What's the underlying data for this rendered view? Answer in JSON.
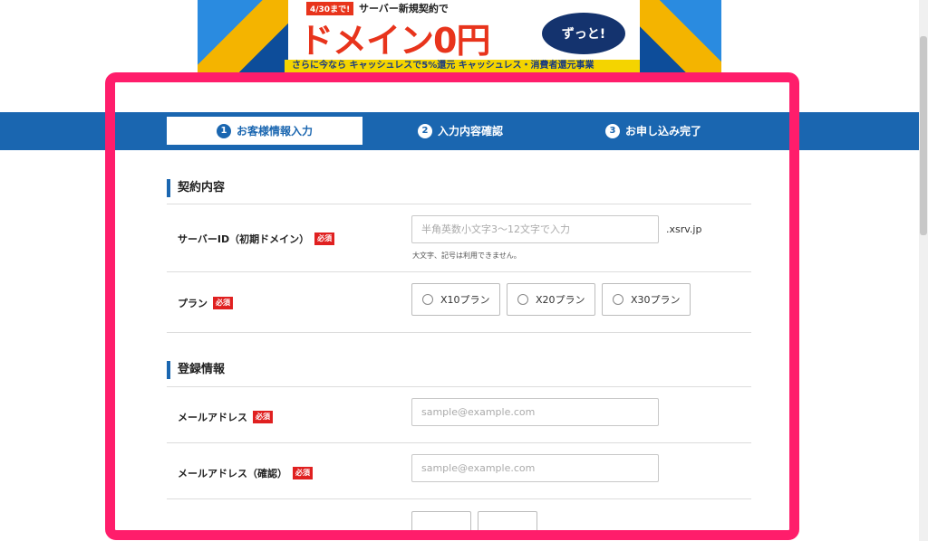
{
  "banner": {
    "date_tag": "4/30まで!",
    "lead": "サーバー新規契約で",
    "headline": "ドメイン0円",
    "bubble": "ずっと!",
    "bottom_strip": "さらに今なら キャッシュレスで5%還元 キャッシュレス・消費者還元事業"
  },
  "steps": [
    {
      "num": "1",
      "label": "お客様情報入力",
      "active": true
    },
    {
      "num": "2",
      "label": "入力内容確認",
      "active": false
    },
    {
      "num": "3",
      "label": "お申し込み完了",
      "active": false
    }
  ],
  "sections": {
    "contract": {
      "title": "契約内容"
    },
    "registration": {
      "title": "登録情報"
    }
  },
  "required_badge": "必須",
  "fields": {
    "server_id": {
      "label": "サーバーID（初期ドメイン）",
      "placeholder": "半角英数小文字3〜12文字で入力",
      "value": "",
      "suffix": ".xsrv.jp",
      "note": "大文字、記号は利用できません。"
    },
    "plan": {
      "label": "プラン",
      "options": [
        "X10プラン",
        "X20プラン",
        "X30プラン"
      ]
    },
    "email": {
      "label": "メールアドレス",
      "placeholder": "sample@example.com",
      "value": ""
    },
    "email_confirm": {
      "label": "メールアドレス（確認）",
      "placeholder": "sample@example.com",
      "value": ""
    }
  },
  "colors": {
    "brand_blue": "#1a66b0",
    "required_red": "#e02020",
    "highlight_pink": "#ff1d6b"
  }
}
